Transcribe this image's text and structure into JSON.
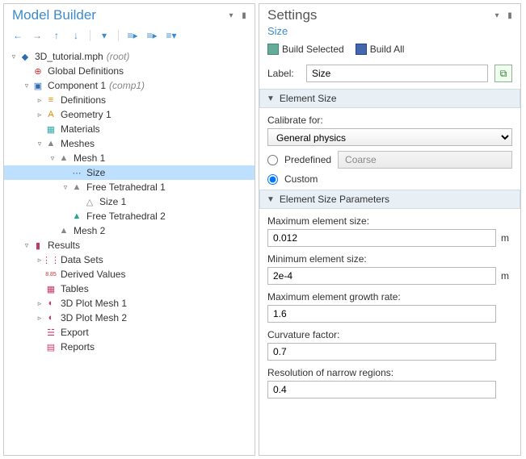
{
  "modelBuilder": {
    "title": "Model Builder",
    "tree": [
      {
        "d": 0,
        "e": "▿",
        "ic": "◆",
        "c": "i-blue",
        "t": "3D_tutorial.mph",
        "a": "(root)"
      },
      {
        "d": 1,
        "e": "",
        "ic": "⊕",
        "c": "i-red",
        "t": "Global Definitions"
      },
      {
        "d": 1,
        "e": "▿",
        "ic": "▣",
        "c": "i-blue",
        "t": "Component 1",
        "a": "(comp1)"
      },
      {
        "d": 2,
        "e": "▹",
        "ic": "≡",
        "c": "i-orange",
        "t": "Definitions"
      },
      {
        "d": 2,
        "e": "▹",
        "ic": "A",
        "c": "i-orange",
        "t": "Geometry 1"
      },
      {
        "d": 2,
        "e": "",
        "ic": "▦",
        "c": "i-cyan",
        "t": "Materials"
      },
      {
        "d": 2,
        "e": "▿",
        "ic": "▲",
        "c": "i-gray",
        "t": "Meshes"
      },
      {
        "d": 3,
        "e": "▿",
        "ic": "▲",
        "c": "i-gray",
        "t": "Mesh 1"
      },
      {
        "d": 4,
        "e": "",
        "ic": "⋯",
        "c": "i-blue",
        "t": "Size",
        "sel": true
      },
      {
        "d": 4,
        "e": "▿",
        "ic": "▲",
        "c": "i-gray",
        "t": "Free Tetrahedral 1"
      },
      {
        "d": 5,
        "e": "",
        "ic": "△",
        "c": "i-gray",
        "t": "Size 1"
      },
      {
        "d": 4,
        "e": "",
        "ic": "▲",
        "c": "i-green",
        "t": "Free Tetrahedral 2"
      },
      {
        "d": 3,
        "e": "",
        "ic": "▲",
        "c": "i-gray",
        "t": "Mesh 2"
      },
      {
        "d": 1,
        "e": "▿",
        "ic": "▮",
        "c": "i-pink",
        "t": "Results"
      },
      {
        "d": 2,
        "e": "▹",
        "ic": "⋮⋮",
        "c": "i-pink",
        "t": "Data Sets"
      },
      {
        "d": 2,
        "e": "",
        "ic": "8.85",
        "c": "i-red",
        "t": "Derived Values"
      },
      {
        "d": 2,
        "e": "",
        "ic": "▦",
        "c": "i-pink",
        "t": "Tables"
      },
      {
        "d": 2,
        "e": "▹",
        "ic": "◐",
        "c": "i-pink",
        "t": "3D Plot Mesh 1"
      },
      {
        "d": 2,
        "e": "▹",
        "ic": "◐",
        "c": "i-pink",
        "t": "3D Plot Mesh 2"
      },
      {
        "d": 2,
        "e": "",
        "ic": "☱",
        "c": "i-pink",
        "t": "Export"
      },
      {
        "d": 2,
        "e": "",
        "ic": "▤",
        "c": "i-pink",
        "t": "Reports"
      }
    ]
  },
  "settings": {
    "title": "Settings",
    "subtitle": "Size",
    "buildSelected": "Build Selected",
    "buildAll": "Build All",
    "labelLabel": "Label:",
    "labelValue": "Size",
    "sec1": "Element Size",
    "calibrateLabel": "Calibrate for:",
    "calibrateValue": "General physics",
    "predefined": "Predefined",
    "predefinedValue": "Coarse",
    "custom": "Custom",
    "sec2": "Element Size Parameters",
    "params": [
      {
        "label": "Maximum element size:",
        "value": "0.012",
        "unit": "m"
      },
      {
        "label": "Minimum element size:",
        "value": "2e-4",
        "unit": "m"
      },
      {
        "label": "Maximum element growth rate:",
        "value": "1.6",
        "unit": ""
      },
      {
        "label": "Curvature factor:",
        "value": "0.7",
        "unit": ""
      },
      {
        "label": "Resolution of narrow regions:",
        "value": "0.4",
        "unit": ""
      }
    ]
  }
}
